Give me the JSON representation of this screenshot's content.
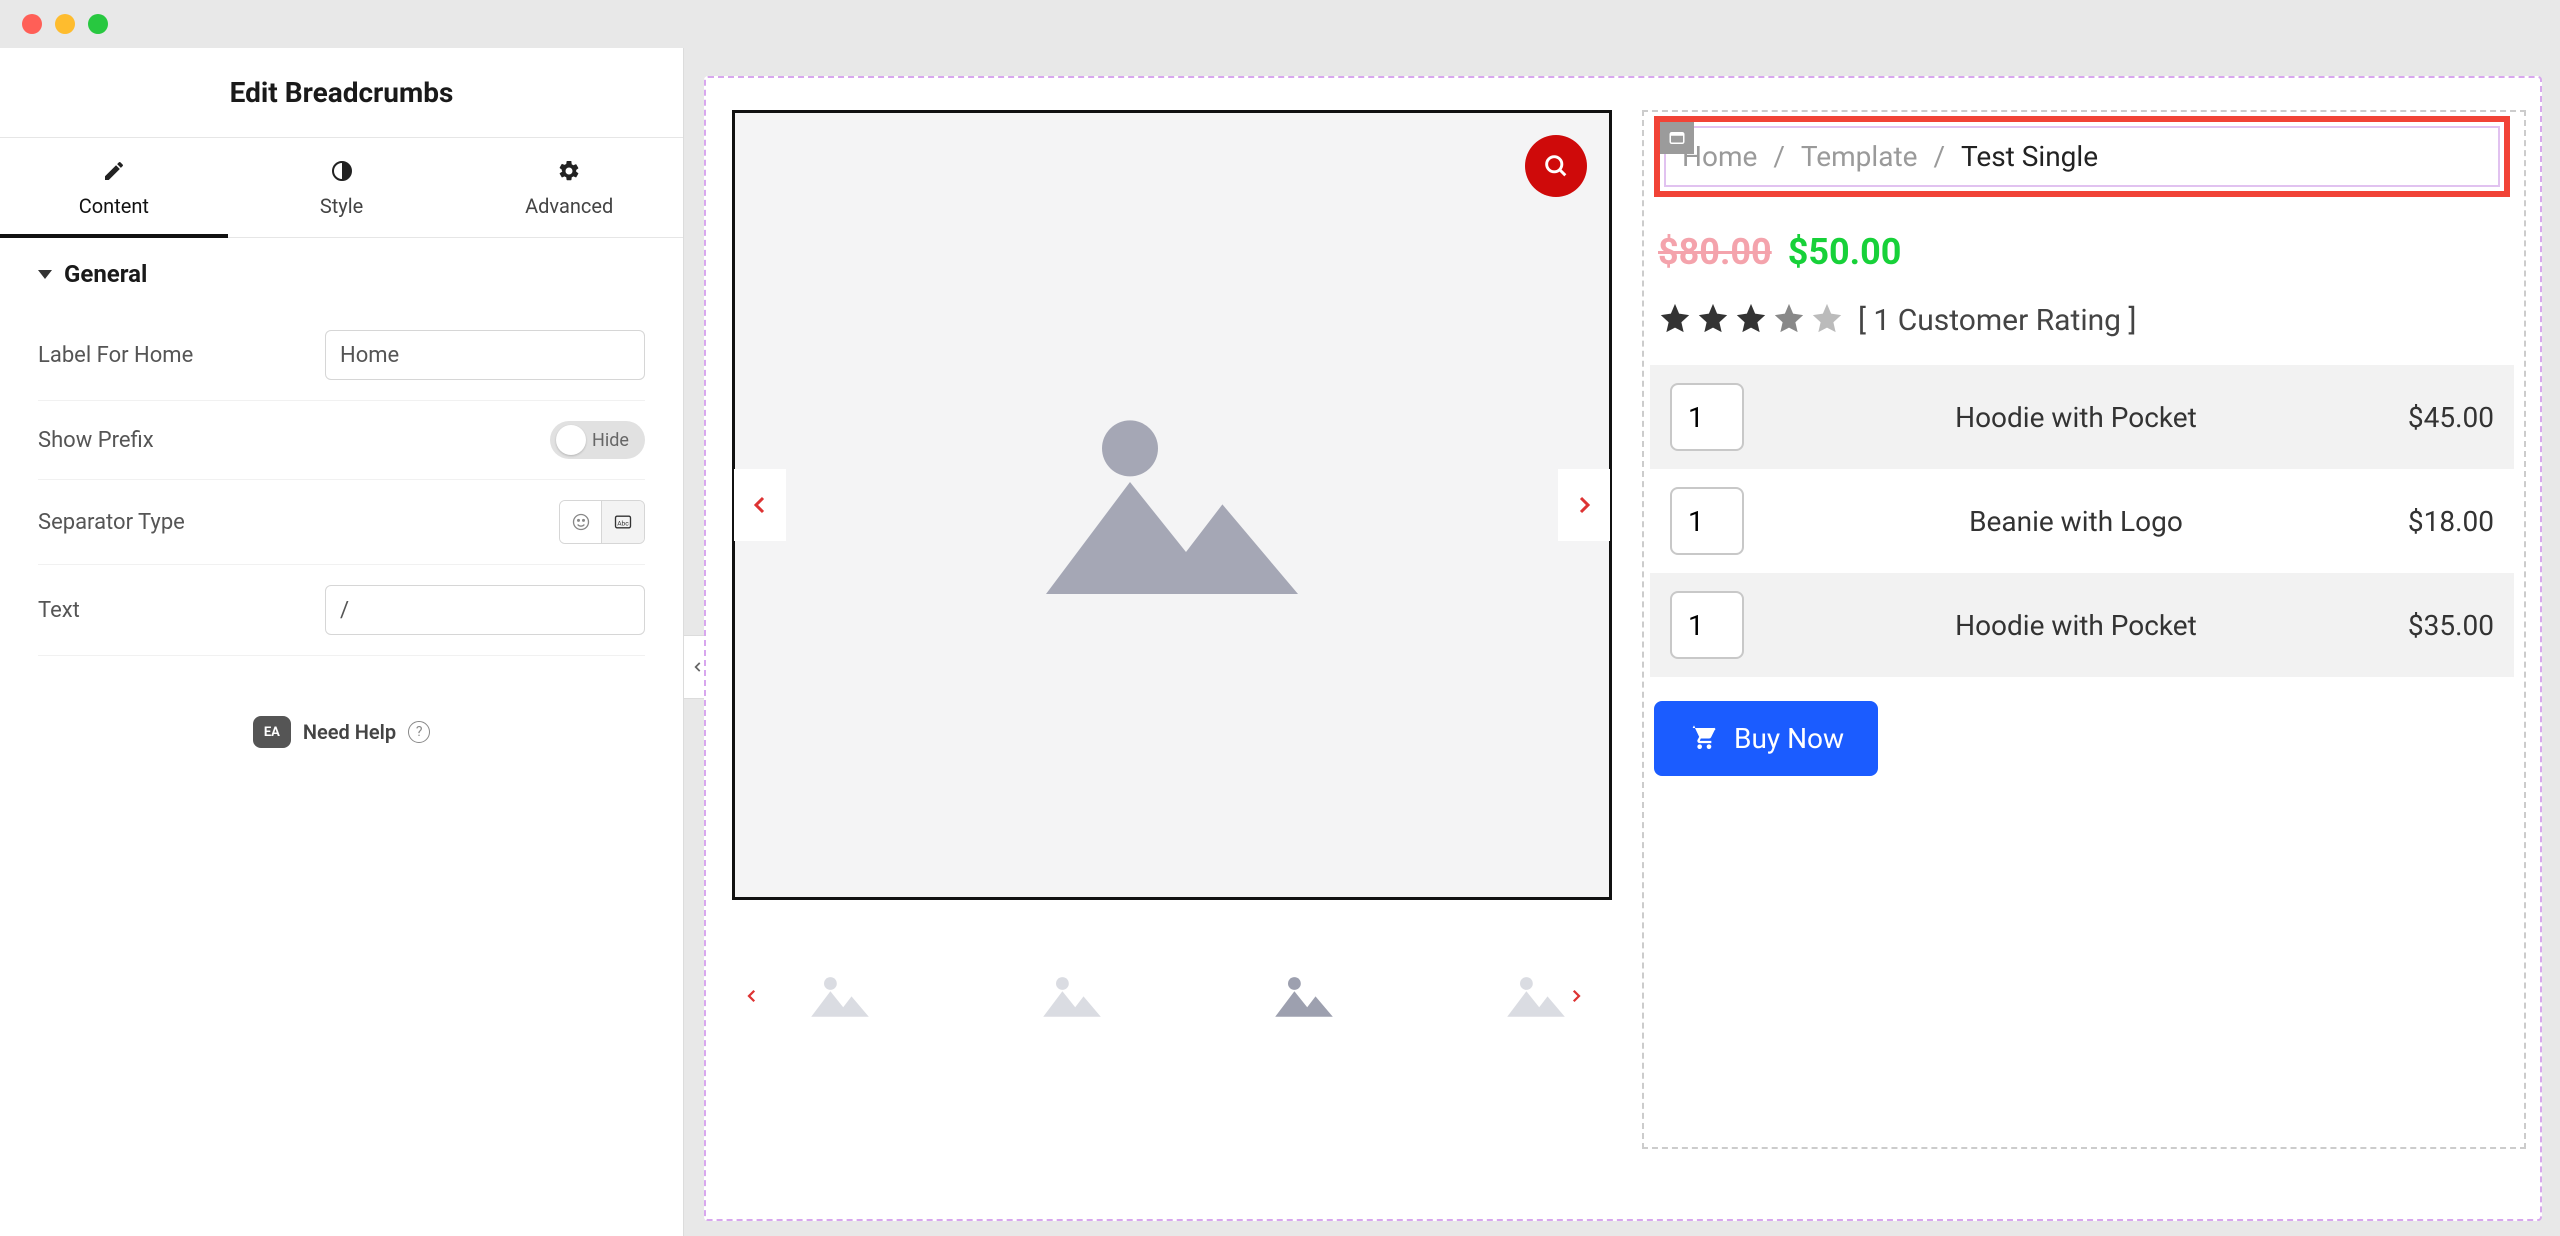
{
  "window": {
    "traffic_lights": [
      "close",
      "minimize",
      "zoom"
    ]
  },
  "sidebar": {
    "title": "Edit Breadcrumbs",
    "tabs": [
      {
        "id": "content",
        "label": "Content",
        "icon": "pencil-icon",
        "active": true
      },
      {
        "id": "style",
        "label": "Style",
        "icon": "contrast-icon",
        "active": false
      },
      {
        "id": "advanced",
        "label": "Advanced",
        "icon": "gear-icon",
        "active": false
      }
    ],
    "section": {
      "title": "General",
      "label_for_home": {
        "label": "Label For Home",
        "value": "Home"
      },
      "show_prefix": {
        "label": "Show Prefix",
        "value": "Hide",
        "on": false
      },
      "separator_type": {
        "label": "Separator Type",
        "options": [
          "emoji",
          "text"
        ],
        "active": "text"
      },
      "text": {
        "label": "Text",
        "value": "/"
      }
    },
    "need_help": {
      "badge": "EA",
      "text": "Need Help"
    }
  },
  "toolbar": {
    "add": "+",
    "drag": "⠿",
    "close": "×"
  },
  "gallery": {
    "thumbs_count": 4,
    "active_thumb": 2
  },
  "breadcrumb": {
    "items": [
      "Home",
      "Template",
      "Test Single"
    ],
    "separator": "/"
  },
  "product": {
    "price_old": "$80.00",
    "price_new": "$50.00",
    "rating_stars": 3,
    "rating_text": "[ 1 Customer Rating ]",
    "bundle": [
      {
        "qty": "1",
        "name": "Hoodie with Pocket",
        "price": "$45.00"
      },
      {
        "qty": "1",
        "name": "Beanie with Logo",
        "price": "$18.00"
      },
      {
        "qty": "1",
        "name": "Hoodie with Pocket",
        "price": "$35.00"
      }
    ],
    "buy_label": "Buy Now"
  }
}
